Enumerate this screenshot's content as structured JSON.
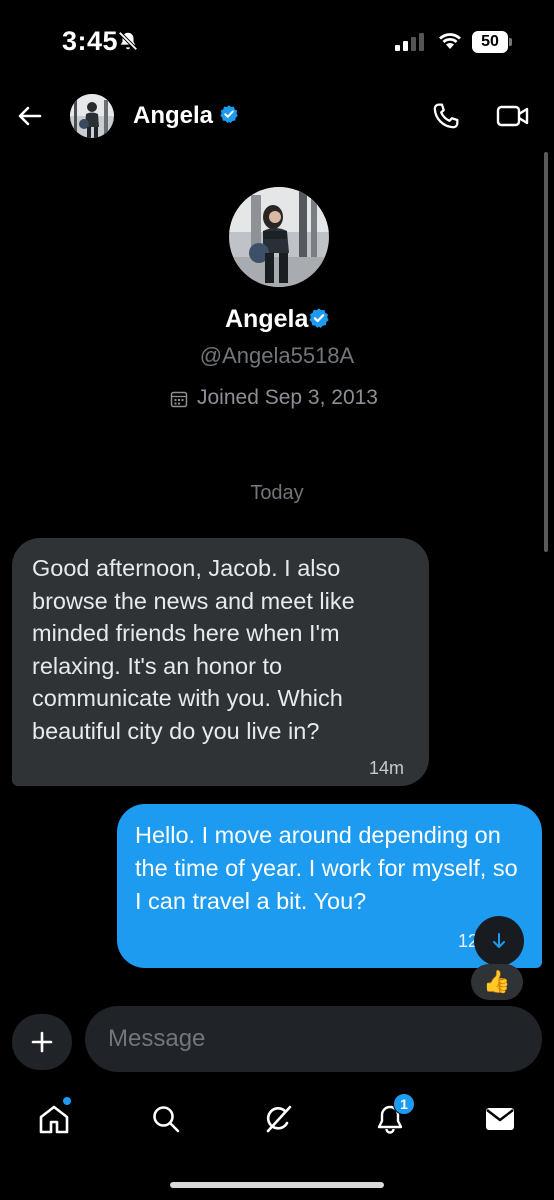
{
  "status_bar": {
    "time": "3:45",
    "battery": "50",
    "icons": [
      "bell-off-icon",
      "signal-icon",
      "wifi-icon",
      "battery-icon"
    ]
  },
  "header": {
    "name": "Angela",
    "icons": [
      "back-arrow-icon",
      "verified-badge-icon",
      "phone-icon",
      "video-call-icon"
    ]
  },
  "profile": {
    "name": "Angela",
    "handle": "@Angela5518A",
    "joined": "Joined Sep 3, 2013"
  },
  "conversation": {
    "date_label": "Today",
    "messages": [
      {
        "direction": "incoming",
        "text": "Good afternoon, Jacob. I also browse the news and meet like minded friends here when I'm relaxing. It's an honor to communicate with you. Which beautiful city do you live in?",
        "time": "14m"
      },
      {
        "direction": "outgoing",
        "text": "Hello. I move around depending on the time of year. I work for myself, so I can travel a bit. You?",
        "time": "12",
        "reaction": "👍"
      }
    ]
  },
  "composer": {
    "placeholder": "Message"
  },
  "bottom_nav": {
    "items": [
      "home-icon",
      "search-icon",
      "grok-icon",
      "notifications-icon",
      "messages-icon"
    ],
    "notification_count": "1"
  },
  "colors": {
    "background": "#000000",
    "accent": "#1d9bf0",
    "incoming_bubble": "#2f3336",
    "muted_text": "#71767b"
  }
}
